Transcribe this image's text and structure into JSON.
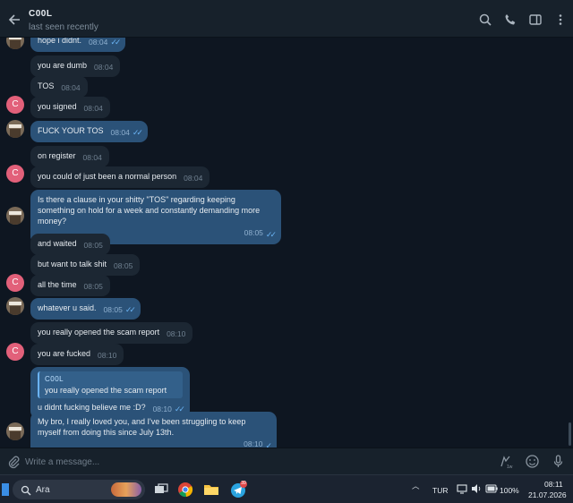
{
  "header": {
    "title": "C00L",
    "status": "last seen recently"
  },
  "messages": [
    {
      "text": "hope i didnt.",
      "time": "08:04",
      "dir": "out"
    },
    {
      "text": "you are dumb",
      "time": "08:04",
      "dir": "in"
    },
    {
      "text": "TOS",
      "time": "08:04",
      "dir": "in"
    },
    {
      "text": "you signed",
      "time": "08:04",
      "dir": "in"
    },
    {
      "text": "FUCK YOUR TOS",
      "time": "08:04",
      "dir": "out"
    },
    {
      "text": "on register",
      "time": "08:04",
      "dir": "in"
    },
    {
      "text": "you could of just been a normal person",
      "time": "08:04",
      "dir": "in"
    },
    {
      "text": "Is there a clause in your shitty \"TOS\" regarding keeping something on hold for a week and constantly demanding more money?",
      "time": "08:05",
      "dir": "out"
    },
    {
      "text": "and waited",
      "time": "08:05",
      "dir": "in"
    },
    {
      "text": "but want to talk shit",
      "time": "08:05",
      "dir": "in"
    },
    {
      "text": "all the time",
      "time": "08:05",
      "dir": "in"
    },
    {
      "text": "whatever u said.",
      "time": "08:05",
      "dir": "out"
    },
    {
      "text": "you really opened the scam report",
      "time": "08:10",
      "dir": "in"
    },
    {
      "text": "you are fucked",
      "time": "08:10",
      "dir": "in"
    },
    {
      "text": "u didnt fucking believe me :D?",
      "time": "08:10",
      "dir": "out",
      "reply_name": "C00L",
      "reply_text": "you really opened the scam report"
    },
    {
      "text": "My bro, I really loved you, and I've been struggling to keep myself from doing this since July 13th.",
      "time": "08:10",
      "dir": "out"
    }
  ],
  "avatar_letter": "C",
  "composer": {
    "placeholder": "Write a message..."
  },
  "taskbar": {
    "search_label": "Ara",
    "language": "TUR",
    "battery": "100%",
    "time": "08:11",
    "date": "21.07.2026",
    "telegram_badge": "39"
  },
  "colors": {
    "bg": "#0e1621",
    "header": "#17212b",
    "incoming": "#1c2733",
    "outgoing": "#2b5278",
    "avatar": "#e2607a",
    "accent": "#6ab2f2"
  }
}
